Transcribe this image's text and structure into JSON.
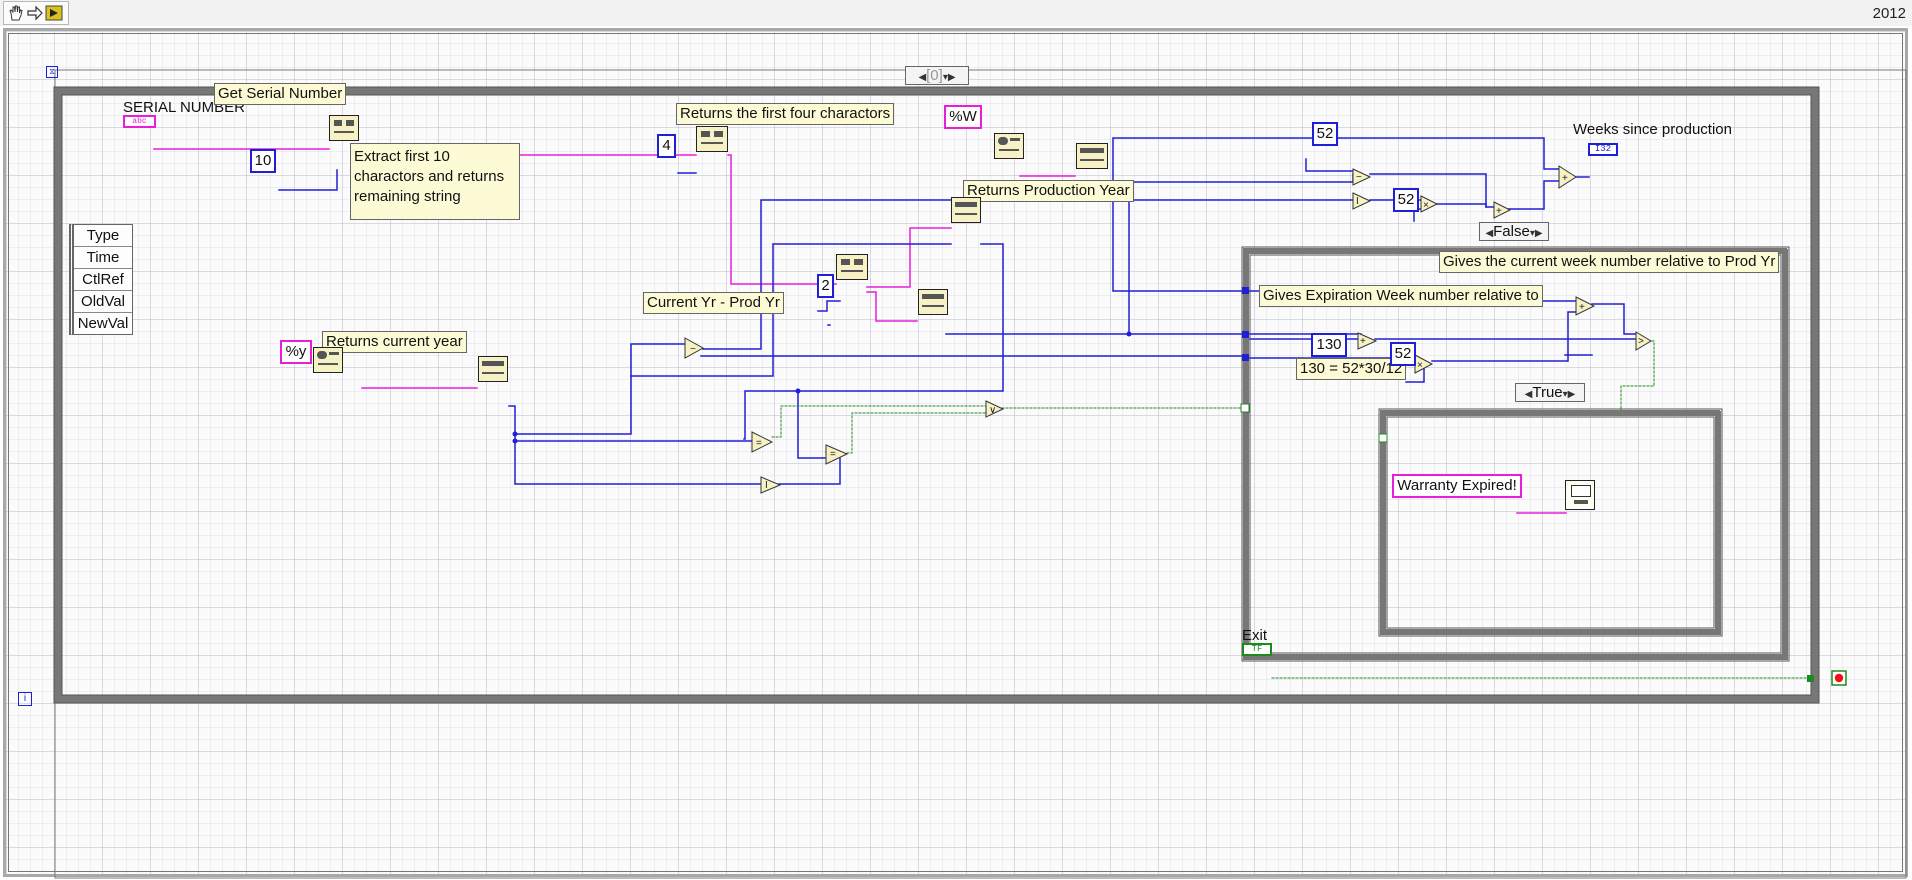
{
  "toolbar": {
    "tools": [
      {
        "name": "hand-tool-icon"
      },
      {
        "name": "arrow-tool-icon"
      },
      {
        "name": "highlight-execution-icon"
      }
    ],
    "version": "2012"
  },
  "frame": {
    "sequence_selector": "[0]",
    "false_case_selector": "False",
    "true_case_selector": "True",
    "iteration_terminal": "i",
    "loop_indicator": "N"
  },
  "event_data": {
    "fields": [
      "Type",
      "Time",
      "CtlRef",
      "OldVal",
      "NewVal"
    ]
  },
  "labels": {
    "serial_number": "SERIAL NUMBER",
    "weeks_since_production": "Weeks since production",
    "exit": "Exit"
  },
  "terminals": {
    "serial_number_type": "abc",
    "weeks_type": "I32",
    "exit_type": "TF"
  },
  "comments": {
    "get_serial": "Get Serial Number",
    "extract": "Extract first 10 charactors and returns remaining string",
    "first_four": "Returns the first four charactors",
    "prod_year": "Returns Production Year",
    "current_minus_prod": "Current Yr - Prod Yr",
    "current_year": "Returns current year",
    "current_week": "Gives the current week number relative to Prod Yr",
    "expiration_week": "Gives Expiration Week number relative to",
    "formula": "130 = 52*30/12"
  },
  "constants": {
    "n10": "10",
    "n4": "4",
    "n2": "2",
    "n52a": "52",
    "n52b": "52",
    "n52c": "52",
    "n130": "130"
  },
  "strings": {
    "pct_w": "%W",
    "pct_y": "%y",
    "warranty": "Warranty Expired!"
  },
  "colors": {
    "string_wire": "#e61fd9",
    "numeric_wire": "#1f1fd6",
    "boolean_wire": "#1e8a1e",
    "comment_bg": "#fdfbd6"
  }
}
